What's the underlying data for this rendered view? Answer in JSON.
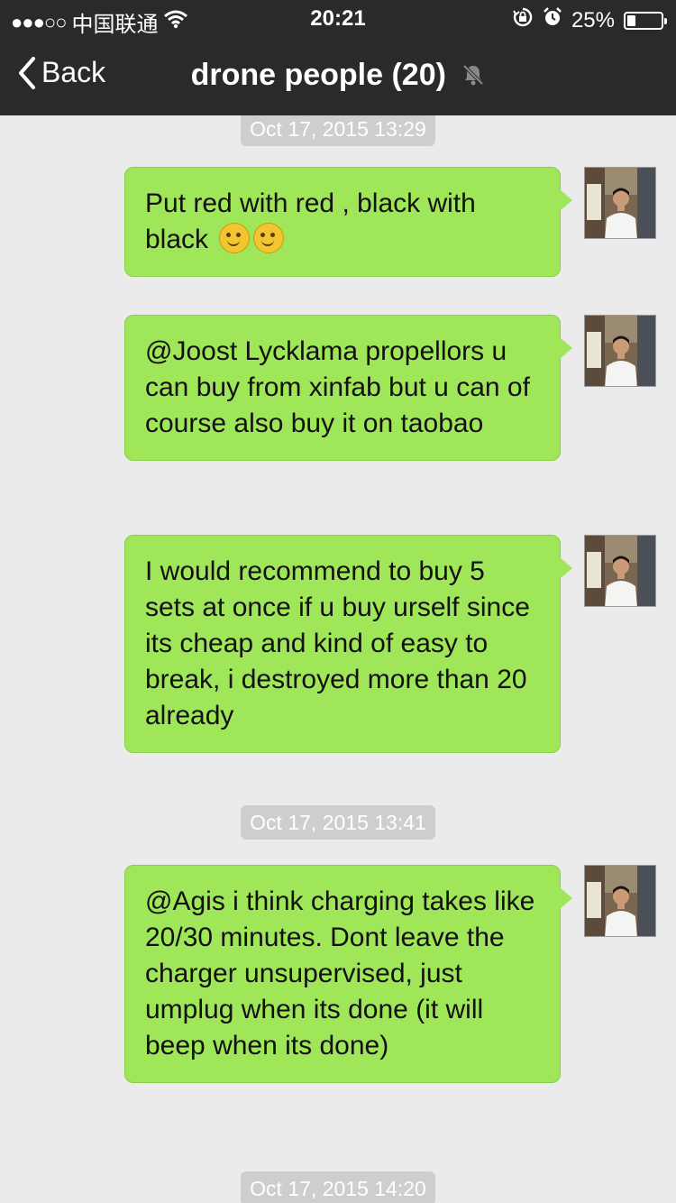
{
  "status_bar": {
    "signal_dots": "●●●○○",
    "carrier": "中国联通",
    "time": "20:21",
    "battery_percent_text": "25%",
    "battery_level": 0.25
  },
  "nav": {
    "back_label": "Back",
    "title": "drone people (20)"
  },
  "messages": [
    {
      "timestamp": "Oct 17, 2015 13:29"
    },
    {
      "text": "Put red with red , black with black",
      "emoji": [
        "smile",
        "smile"
      ]
    },
    {
      "text": "@Joost Lycklama propellors u can buy from xinfab but u can of course also buy it on taobao"
    },
    {
      "text": "I would recommend to buy 5 sets at once if u buy urself since its cheap and kind of easy to break, i destroyed more than 20 already"
    },
    {
      "timestamp": "Oct 17, 2015 13:41"
    },
    {
      "text": "@Agis i think charging takes like 20/30 minutes. Dont leave the charger unsupervised, just umplug when its done (it will beep when its done)"
    },
    {
      "timestamp": "Oct 17, 2015 14:20"
    }
  ],
  "colors": {
    "bubble": "#9fe659",
    "header": "#2a2a2c",
    "background": "#ebebeb"
  }
}
